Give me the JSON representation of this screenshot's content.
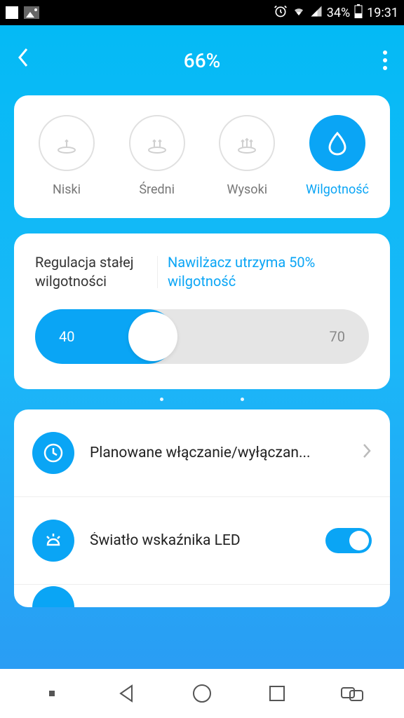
{
  "status": {
    "battery_pct": "34%",
    "time": "19:31"
  },
  "header": {
    "title": "66%"
  },
  "modes": {
    "items": [
      {
        "label": "Niski"
      },
      {
        "label": "Średni"
      },
      {
        "label": "Wysoki"
      },
      {
        "label": "Wilgotność"
      }
    ]
  },
  "humidity": {
    "title": "Regulacja stałej wilgotności",
    "status": "Nawilżacz utrzyma 50% wilgotność",
    "min": "40",
    "max": "70"
  },
  "settings": {
    "schedule": {
      "label": "Planowane włączanie/wyłączan..."
    },
    "led": {
      "label": "Światło wskaźnika LED"
    }
  }
}
